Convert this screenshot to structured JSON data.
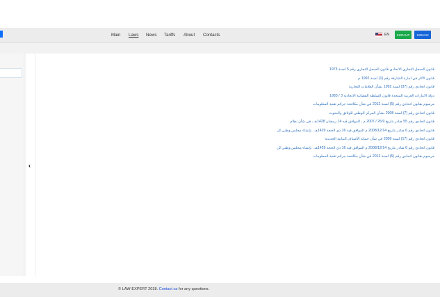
{
  "nav": {
    "items": [
      {
        "label": "Main"
      },
      {
        "label": "Laws"
      },
      {
        "label": "News"
      },
      {
        "label": "Tariffs"
      },
      {
        "label": "About"
      },
      {
        "label": "Contacts"
      }
    ],
    "active": "Laws"
  },
  "language": {
    "code": "EN",
    "flag_icon": "us-flag-icon"
  },
  "buttons": {
    "signup": "SIGN UP",
    "signin": "SIGN IN"
  },
  "colors": {
    "signup": "#19a84a",
    "signin": "#1565d8",
    "link": "#2a6ebb"
  },
  "laws": [
    "قانون السجل التجاري الاتحادي قانون السجل التجاري رقم 5 لسنة 1973",
    "قانون الآثار في امارة الشارقة رقم (1) لسنة 1992 م",
    "قانون اتحادي رقم (37) لسنة 1992 بشأن العلامات التجارية",
    "دولة الامارات العربية المتحدة قانون السلطة القضائية الاتحادية 3 / 1983",
    "مرسوم بقانون اتحادي رقم (5) لسنة 2012 في شأن مكافحة جرائم تقنية المعلومات",
    "قانون اتحادي رقم (7) لسنة 2008 بشأن المركز الوطني للوثائق والبحوث",
    "قانون اتحادي رقم 55 صادر بتاريخ 26/9 / 2007 م ، الموافق فيه 14 رمضان 1428هـ ، في شأن نظام",
    "قانون اتحادي رقم 6 صادر بتاريخ 2008/12/14 م الموافق فيه 16 ذي الحجة 1429هـ . بإنشاء مجلس وطني لل",
    "قانون اتحادي رقم (17) لسنة 2009 في شأن حماية الأصناف النباتية الجديدة",
    "قانون اتحادي رقم 6 صادر بتاريخ 2008/12/14 م الموافق فيه 16 ذي الحجة 1429هـ . بإنشاء مجلس وطني لل",
    "مرسوم بقانون اتحادي رقم (5) لسنة 2012 في شأن مكافحة جرائم تقنية المعلومات"
  ],
  "footer": {
    "copyright": "© LAW-EXPERT 2018.",
    "contact_link": "Contact us",
    "suffix": "for any questions."
  }
}
